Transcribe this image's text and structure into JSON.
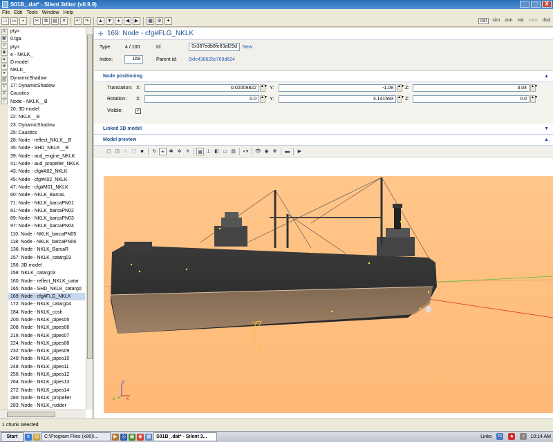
{
  "window": {
    "title": "S01B_.dat* - Silent 3ditor (v0.9.9)",
    "min": "_",
    "max": "□",
    "close": "X"
  },
  "menu": [
    "File",
    "Edit",
    "Tools",
    "Window",
    "Help"
  ],
  "mode_tabs": [
    "dat",
    "sim",
    "zon",
    "val",
    "cam",
    "dsd"
  ],
  "tree_items": [
    "pty>",
    "0.tga",
    "pty>",
    "e - NKLK_",
    "D model",
    "NKLK_",
    "DynamicShadow",
    "17: DynamicShadow",
    "Caustics",
    "Node - NKLK__B",
    "20: 3D model",
    "22: NKLK__B",
    "23: DynamicShadow",
    "25: Caustics",
    "28: Node - reflect_NKLK__B",
    "35: Node - SHD_NKLK__B",
    "39: Node - aud_engine_NKLK",
    "41: Node - aud_propeller_NKLK",
    "43: Node - cfg#A02_NKLK",
    "45: Node - cfg#K02_NKLK",
    "47: Node - cfg#M01_NKLK",
    "60: Node - NKLK_BarcaL",
    "71: Node - NKLK_barcaPN01",
    "81: Node - NKLK_barcaPN02",
    "89: Node - NKLK_barcaPN03",
    "97: Node - NKLK_barcaPN04",
    "110: Node - NKLK_barcaPN05",
    "118: Node - NKLK_barcaPN06",
    "136: Node - NKLK_BarcaR",
    "157: Node - NKLK_catarg03",
    "156: 3D model",
    "158: NKLK_catarg03",
    "160: Node - reflect_NKLK_catar",
    "165: Node - SHD_NKLK_catarg0",
    "169: Node - cfg#FLG_NKLK",
    "172: Node - NKLK_catarg04",
    "184: Node - NKLK_cosh",
    "200: Node - NKLK_pipes05",
    "208: Node - NKLK_pipes06",
    "216: Node - NKLK_pipes07",
    "224: Node - NKLK_pipes08",
    "232: Node - NKLK_pipes09",
    "240: Node - NKLK_pipes10",
    "248: Node - NKLK_pipes11",
    "256: Node - NKLK_pipes12",
    "264: Node - NKLK_pipes13",
    "272: Node - NKLK_pipes14",
    "280: Node - NKLK_propeller",
    "283: Node - NKLK_rudder"
  ],
  "header": {
    "title": "169: Node - cfg#FLG_NKLK"
  },
  "info": {
    "type_label": "Type:",
    "type_value": "4 / 100",
    "index_label": "Index:",
    "index_value": "169",
    "id_label": "Id:",
    "id_value": "0x387edb8fe83af29d",
    "new_link": "New",
    "parent_label": "Parent id:",
    "parent_value": "0xfc438626c769d624"
  },
  "sections": {
    "node_positioning": "Node positioning",
    "linked_model": "Linked 3D model",
    "model_preview": "Model preview"
  },
  "positioning": {
    "translation_label": "Translation:",
    "rotation_label": "Rotation:",
    "visible_label": "Visible:",
    "x": "X:",
    "y": "Y:",
    "z": "Z:",
    "tx": "0.02009822",
    "ty": "-1.08",
    "tz": "3.04",
    "rx": "0.0",
    "ry": "3.141593",
    "rz": "0.0",
    "visible_check": "✓"
  },
  "status": "1 chunk selected",
  "taskbar": {
    "start": "Start",
    "explorer": "C:\\Program Files (x86)\\...",
    "active": "S01B_.dat* - Silent 3...",
    "links": "Links",
    "time": "10:14 AM"
  },
  "colors": {
    "accent": "#1d4d8d",
    "viewport_bg": "#ffbe7e",
    "titlebar": "#2a6fb8"
  }
}
